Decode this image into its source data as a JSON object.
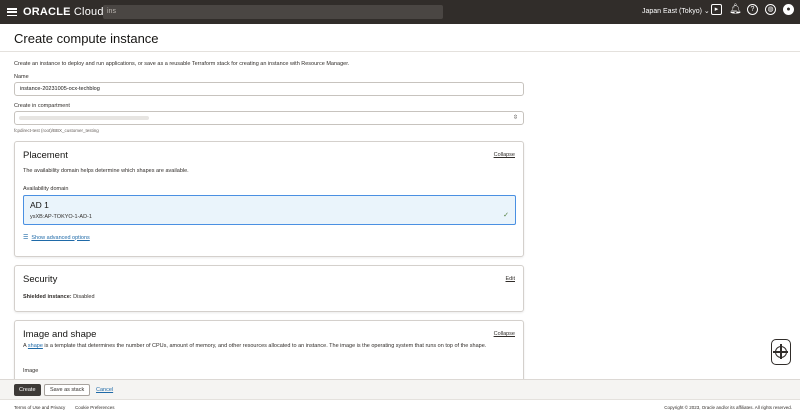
{
  "topbar": {
    "brand_bold": "ORACLE",
    "brand_light": " Cloud",
    "search_value": "ins",
    "region": "Japan East (Tokyo)"
  },
  "page": {
    "title": "Create compute instance",
    "intro": "Create an instance to deploy and run applications, or save as a reusable Terraform stack for creating an instance with Resource Manager."
  },
  "form": {
    "name_label": "Name",
    "name_value": "instance-20231005-ocx-techblog",
    "compartment_label": "Create in compartment",
    "compartment_hint": "fcpdirect-test (root)/BBX_customer_testing"
  },
  "placement": {
    "title": "Placement",
    "collapse_label": "Collapse",
    "description": "The availability domain helps determine which shapes are available.",
    "ad_label": "Availability domain",
    "ad_name": "AD 1",
    "ad_full": "ysXB:AP-TOKYO-1-AD-1",
    "advanced_label": "Show advanced options"
  },
  "security": {
    "title": "Security",
    "edit_label": "Edit",
    "shielded_label": "Shielded instance:",
    "shielded_value": " Disabled"
  },
  "image_shape": {
    "title": "Image and shape",
    "collapse_label": "Collapse",
    "desc_prefix": "A ",
    "desc_link": "shape",
    "desc_rest": " is a template that determines the number of CPUs, amount of memory, and other resources allocated to an instance. The image is the operating system that runs on top of the shape.",
    "image_label": "Image"
  },
  "actions": {
    "create_label": "Create",
    "save_stack_label": "Save as stack",
    "cancel_label": "Cancel"
  },
  "footer": {
    "terms_label": "Terms of Use and Privacy",
    "cookie_label": "Cookie Preferences",
    "copyright": "Copyright © 2023, Oracle and/or its affiliates. All rights reserved."
  }
}
